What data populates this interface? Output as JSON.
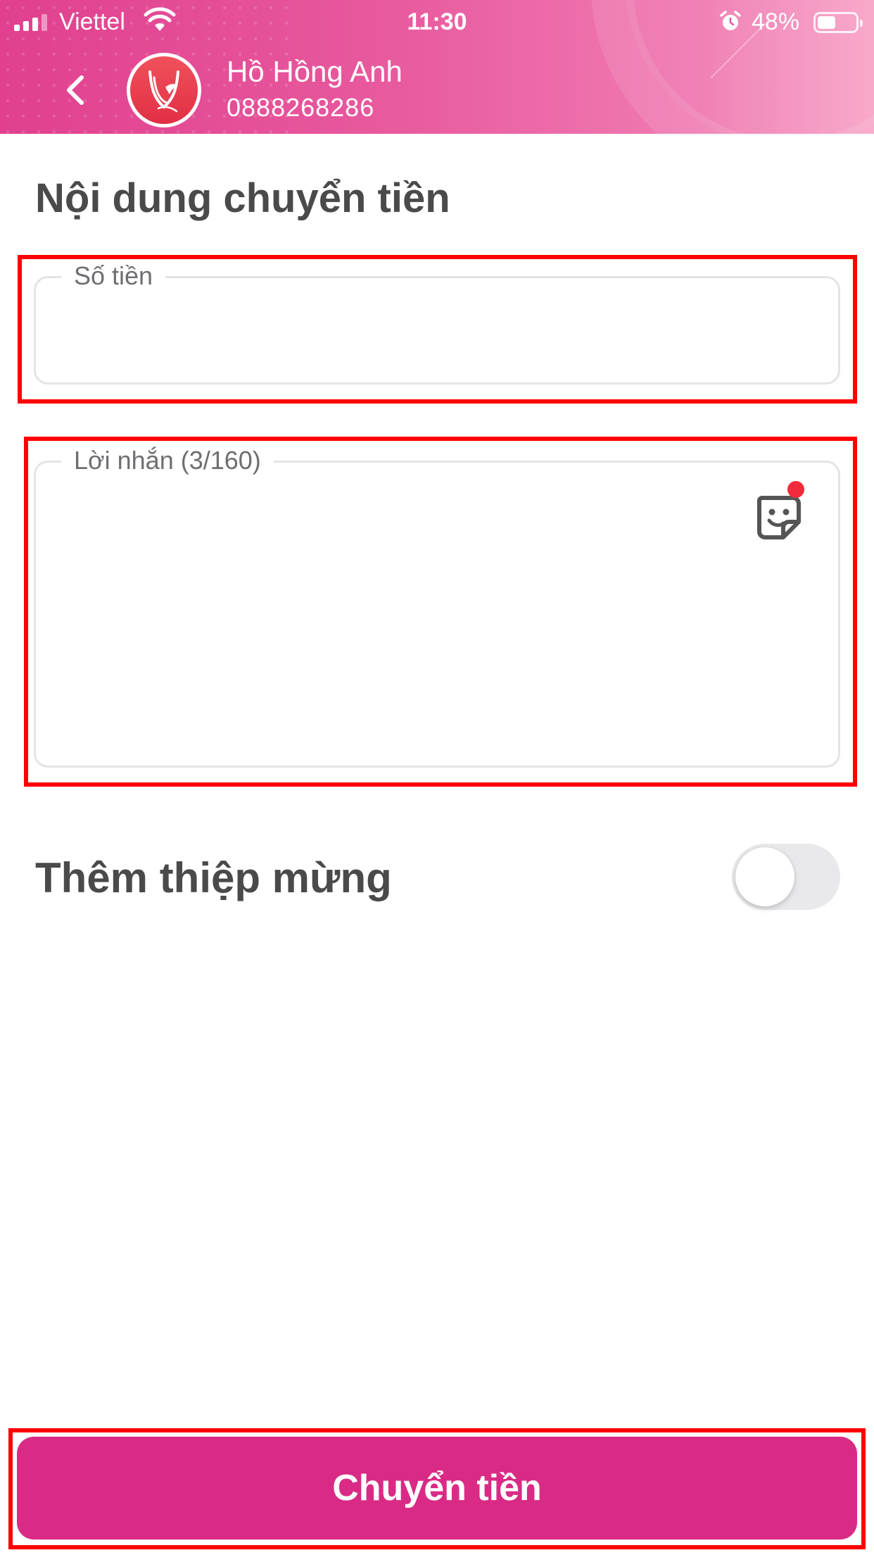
{
  "status_bar": {
    "carrier": "Viettel",
    "time": "11:30",
    "battery_percent": "48%",
    "battery_level": 0.48,
    "icons": [
      "signal-icon",
      "wifi-icon",
      "alarm-icon",
      "battery-icon"
    ]
  },
  "header": {
    "contact_name": "Hồ Hồng Anh",
    "contact_phone": "0888268286",
    "back_icon": "chevron-left-icon",
    "avatar_icon": "bird-logo-icon"
  },
  "form": {
    "section_title": "Nội dung chuyển tiền",
    "amount": {
      "label": "Số tiền",
      "value": ""
    },
    "message": {
      "label": "Lời nhắn (3/160)",
      "value": "",
      "sticker_icon": "sticker-icon"
    },
    "greeting_card": {
      "label": "Thêm thiệp mừng",
      "enabled": false
    }
  },
  "actions": {
    "submit_label": "Chuyển tiền"
  },
  "colors": {
    "header_start": "#e0408f",
    "header_end": "#f8a5c8",
    "primary": "#d92b85",
    "highlight": "#ff0000",
    "text_dark": "#4a4a4a",
    "notification_dot": "#f12b3c"
  }
}
